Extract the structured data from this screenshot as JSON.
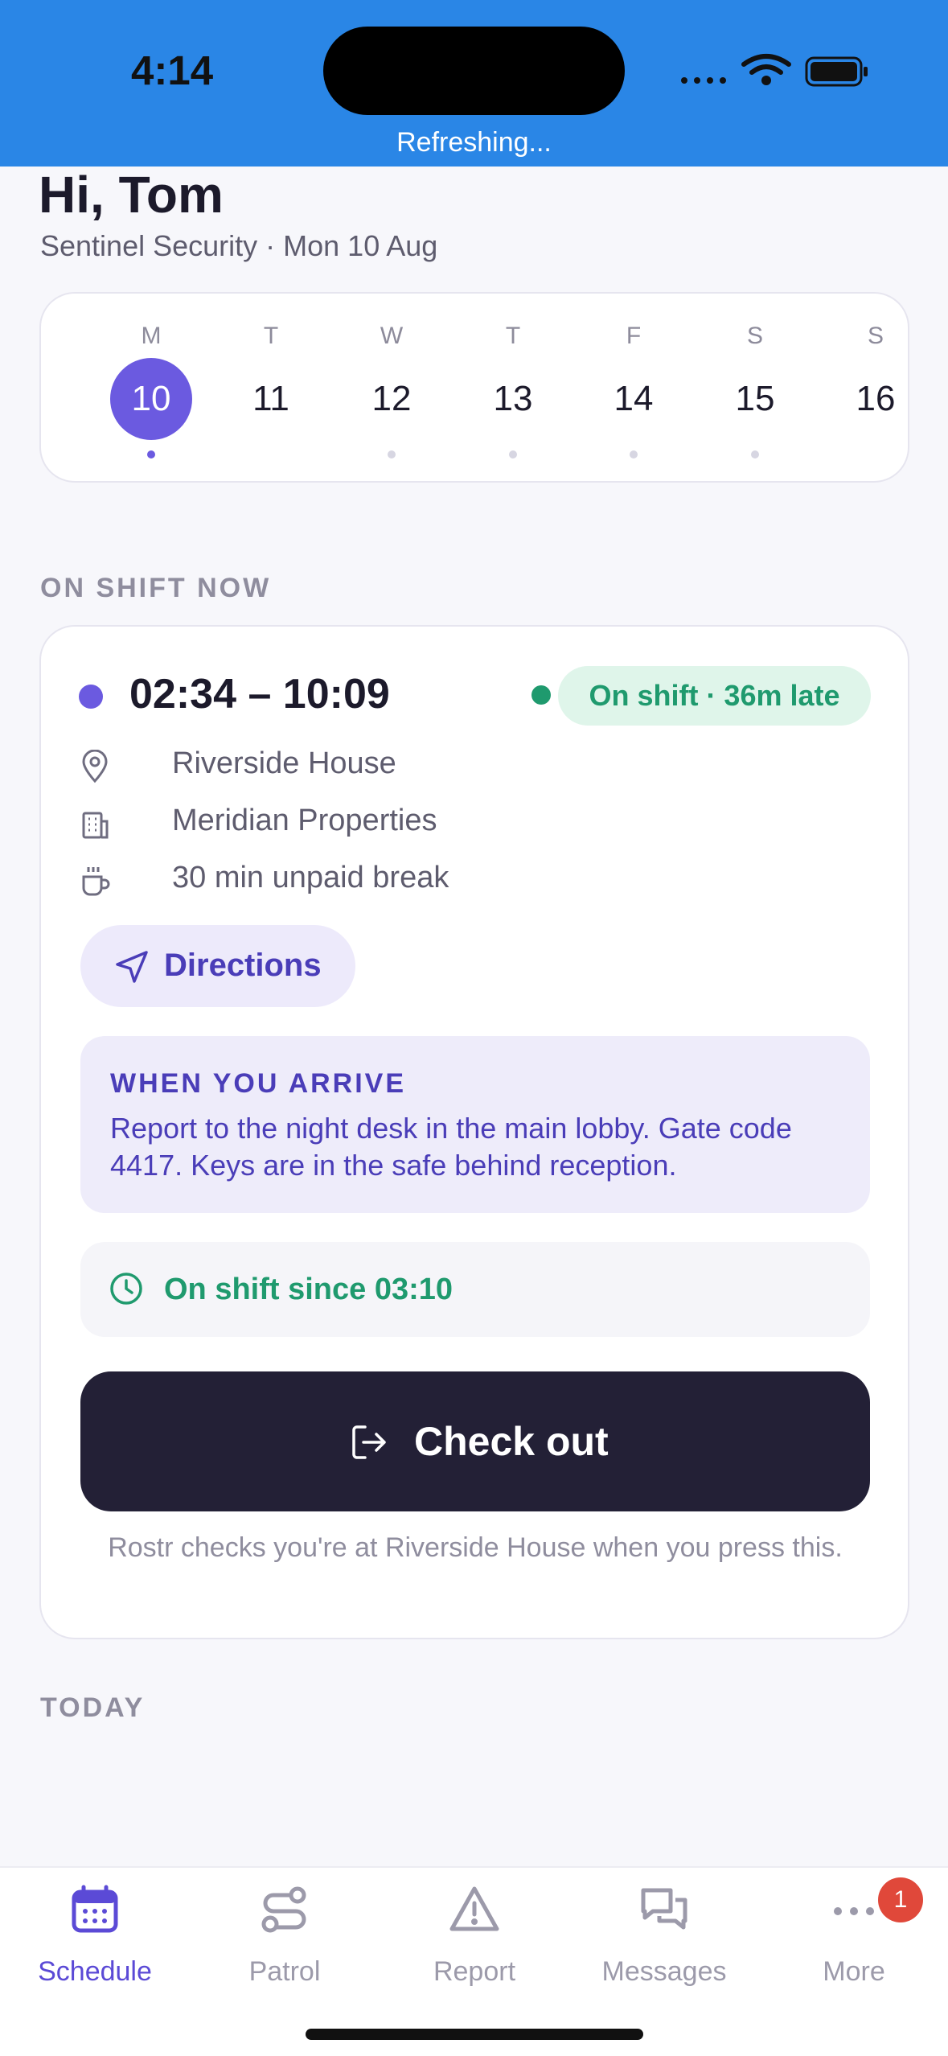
{
  "status_bar": {
    "time": "4:14",
    "refresh_text": "Refreshing..."
  },
  "header": {
    "title": "Hi, Tom",
    "subtitle": "Sentinel Security · Mon 10 Aug"
  },
  "week": {
    "days": [
      {
        "dow": "M",
        "num": "10",
        "selected": true,
        "has_shift": true
      },
      {
        "dow": "T",
        "num": "11",
        "selected": false,
        "has_shift": false
      },
      {
        "dow": "W",
        "num": "12",
        "selected": false,
        "has_shift": true
      },
      {
        "dow": "T",
        "num": "13",
        "selected": false,
        "has_shift": true
      },
      {
        "dow": "F",
        "num": "14",
        "selected": false,
        "has_shift": true
      },
      {
        "dow": "S",
        "num": "15",
        "selected": false,
        "has_shift": true
      },
      {
        "dow": "S",
        "num": "16",
        "selected": false,
        "has_shift": false
      }
    ]
  },
  "on_shift_label": "ON SHIFT NOW",
  "shift": {
    "time_range": "02:34 – 10:09",
    "status_badge": "On shift · 36m late",
    "location": "Riverside House",
    "client": "Meridian Properties",
    "break": "30 min unpaid break",
    "directions_label": "Directions",
    "arrive_title": "WHEN YOU ARRIVE",
    "arrive_body": "Report to the night desk in the main lobby. Gate code 4417. Keys are in the safe behind reception.",
    "since_text": "On shift since 03:10",
    "checkout_label": "Check out",
    "checkout_note": "Rostr checks you're at Riverside House when you press this."
  },
  "today_label": "TODAY",
  "tabs": [
    {
      "label": "Schedule",
      "icon": "calendar-icon",
      "active": true
    },
    {
      "label": "Patrol",
      "icon": "route-icon",
      "active": false
    },
    {
      "label": "Report",
      "icon": "warning-icon",
      "active": false
    },
    {
      "label": "Messages",
      "icon": "chat-icon",
      "active": false
    },
    {
      "label": "More",
      "icon": "more-icon",
      "active": false,
      "badge": "1"
    }
  ],
  "colors": {
    "accent": "#6b5ae0",
    "status_bar": "#2a86e6",
    "success": "#1f9a6e",
    "dark_button": "#232036"
  }
}
